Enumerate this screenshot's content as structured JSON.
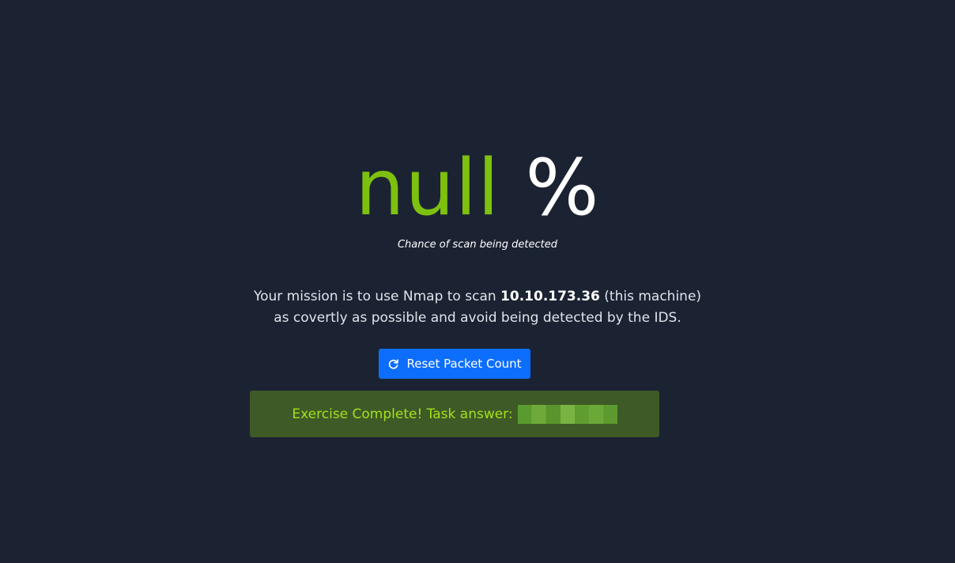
{
  "detection": {
    "value": "null",
    "unit": "%",
    "caption": "Chance of scan being detected"
  },
  "mission": {
    "line1_pre": "Your mission is to use Nmap to scan ",
    "target_ip": "10.10.173.36",
    "line1_post": " (this machine)",
    "line2": "as covertly as possible and avoid being detected by the IDS."
  },
  "reset_button": {
    "icon": "refresh-icon",
    "label": "Reset Packet Count"
  },
  "alert": {
    "text": "Exercise Complete! Task answer:",
    "answer_redacted": true
  },
  "colors": {
    "background": "#1b2333",
    "accent_green": "#7ec00e",
    "button_blue": "#0d6efd",
    "alert_bg": "#3e5a27",
    "alert_text": "#a3e01b"
  }
}
